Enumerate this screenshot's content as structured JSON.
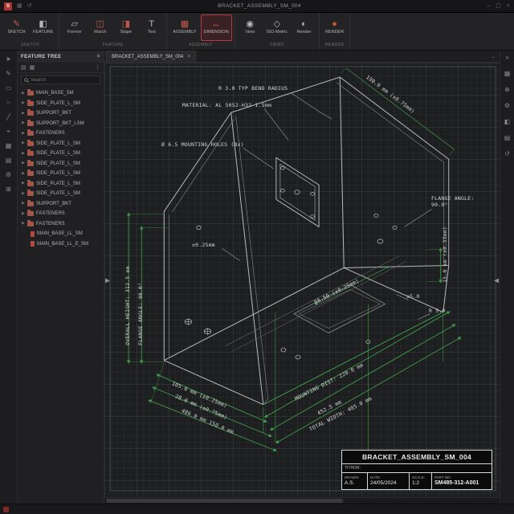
{
  "titlebar": {
    "title": "BRACKET_ASSEMBLY_SM_004"
  },
  "colors": {
    "accent_red": "#b23b3b",
    "dimension_green": "#3f9b4a",
    "render_orange": "#cc5533",
    "folder_red": "#a3564a"
  },
  "ribbon": {
    "groups": [
      {
        "label": "SKETCH",
        "buttons": [
          {
            "label": "SKETCH"
          },
          {
            "label": "FEATURE"
          }
        ]
      },
      {
        "label": "FEATURE",
        "buttons": [
          {
            "label": "Former"
          },
          {
            "label": "March"
          },
          {
            "label": "Stape"
          },
          {
            "label": "Text"
          }
        ]
      },
      {
        "label": "ASSEMBLY",
        "buttons": [
          {
            "label": "ASSEMBLY"
          },
          {
            "label": "DIMENSION",
            "active": true
          }
        ]
      },
      {
        "label": "VIEWS",
        "buttons": [
          {
            "label": "View"
          },
          {
            "label": "ISO-Metric"
          },
          {
            "label": "Render"
          }
        ]
      },
      {
        "label": "RENDER",
        "buttons": [
          {
            "label": "RENDER"
          }
        ]
      }
    ]
  },
  "tab": {
    "label": "BRACKET_ASSEMBLY_SM_004"
  },
  "feature_tree": {
    "title": "FEATURE TREE",
    "search_placeholder": "Search",
    "items": [
      {
        "label": "MAIN_BASE_SM",
        "type": "folder"
      },
      {
        "label": "SIDE_PLATE_L_SM",
        "type": "folder"
      },
      {
        "label": "SUPPORT_BKT",
        "type": "folder"
      },
      {
        "label": "SUPPORT_BKT_LSM",
        "type": "folder"
      },
      {
        "label": "FASTENERS",
        "type": "folder"
      },
      {
        "label": "SIDE_PLATE_L_SM",
        "type": "folder"
      },
      {
        "label": "SIDE_PLATE_L_SM",
        "type": "folder"
      },
      {
        "label": "SIDE_PLATE_L_SM",
        "type": "folder"
      },
      {
        "label": "SIDE_PLATE_L_SM",
        "type": "folder"
      },
      {
        "label": "SIDE_PLATE_L_SM",
        "type": "folder"
      },
      {
        "label": "SIDE_PLATE_L_SM",
        "type": "folder"
      },
      {
        "label": "SUPPORT_BKT",
        "type": "folder"
      },
      {
        "label": "FASTENERS",
        "type": "folder"
      },
      {
        "label": "FASTENERS",
        "type": "folder"
      },
      {
        "label": "MAIN_BASE_LL_SM",
        "type": "file"
      },
      {
        "label": "MAIN_BASE_LL_E_SM",
        "type": "file"
      }
    ]
  },
  "drawing": {
    "annotations": {
      "bend_radius": "R 3.0 TYP BEND RADIUS",
      "material": "MATERIAL: AL 5052-H32 1.5mm",
      "mounting_holes": "Ø 6.5 MOUNTING HOLES (8x)",
      "flange_angle_right_label": "FLANGE ANGLE:",
      "flange_angle_right_value": "90.0°",
      "edge_length": "190.0 mm (±0.75mm)",
      "overall_height": "OVERALL HEIGHT: 312.5 mm",
      "flange_angle_left": "FLANGE ANGLE: 90.0°",
      "tolerance": "±0.25mm",
      "web_dim": "88.50 (±0.25mm)",
      "flange_height": "15.0 mm (±0.33mm)",
      "corner_radius": "R 5.0",
      "tolerance_5": "±5.0",
      "dim_105": "105.0 mm (±0.25mm)",
      "dim_28": "28.0 mm (±0.75mm)",
      "dim_486": "486.0 mm 150.0 mm",
      "mounting_dist": "MOUNTING DIST: 220.0 mm",
      "dim_4525": "452.5 mm",
      "total_width": "TOTAL WIDTH: 485.0 mm"
    },
    "title_block": {
      "title": "BRACKET_ASSEMBLY_SM_004",
      "author_label": "TITHOR:",
      "drawn_label": "DRAWN:",
      "drawn_value": "A.S.",
      "date_label": "DATE:",
      "date_value": "24/05/2024",
      "scale_label": "SCALE:",
      "scale_value": "1:2",
      "part_label": "PART NO:",
      "part_value": "SM485-312-A001"
    }
  }
}
